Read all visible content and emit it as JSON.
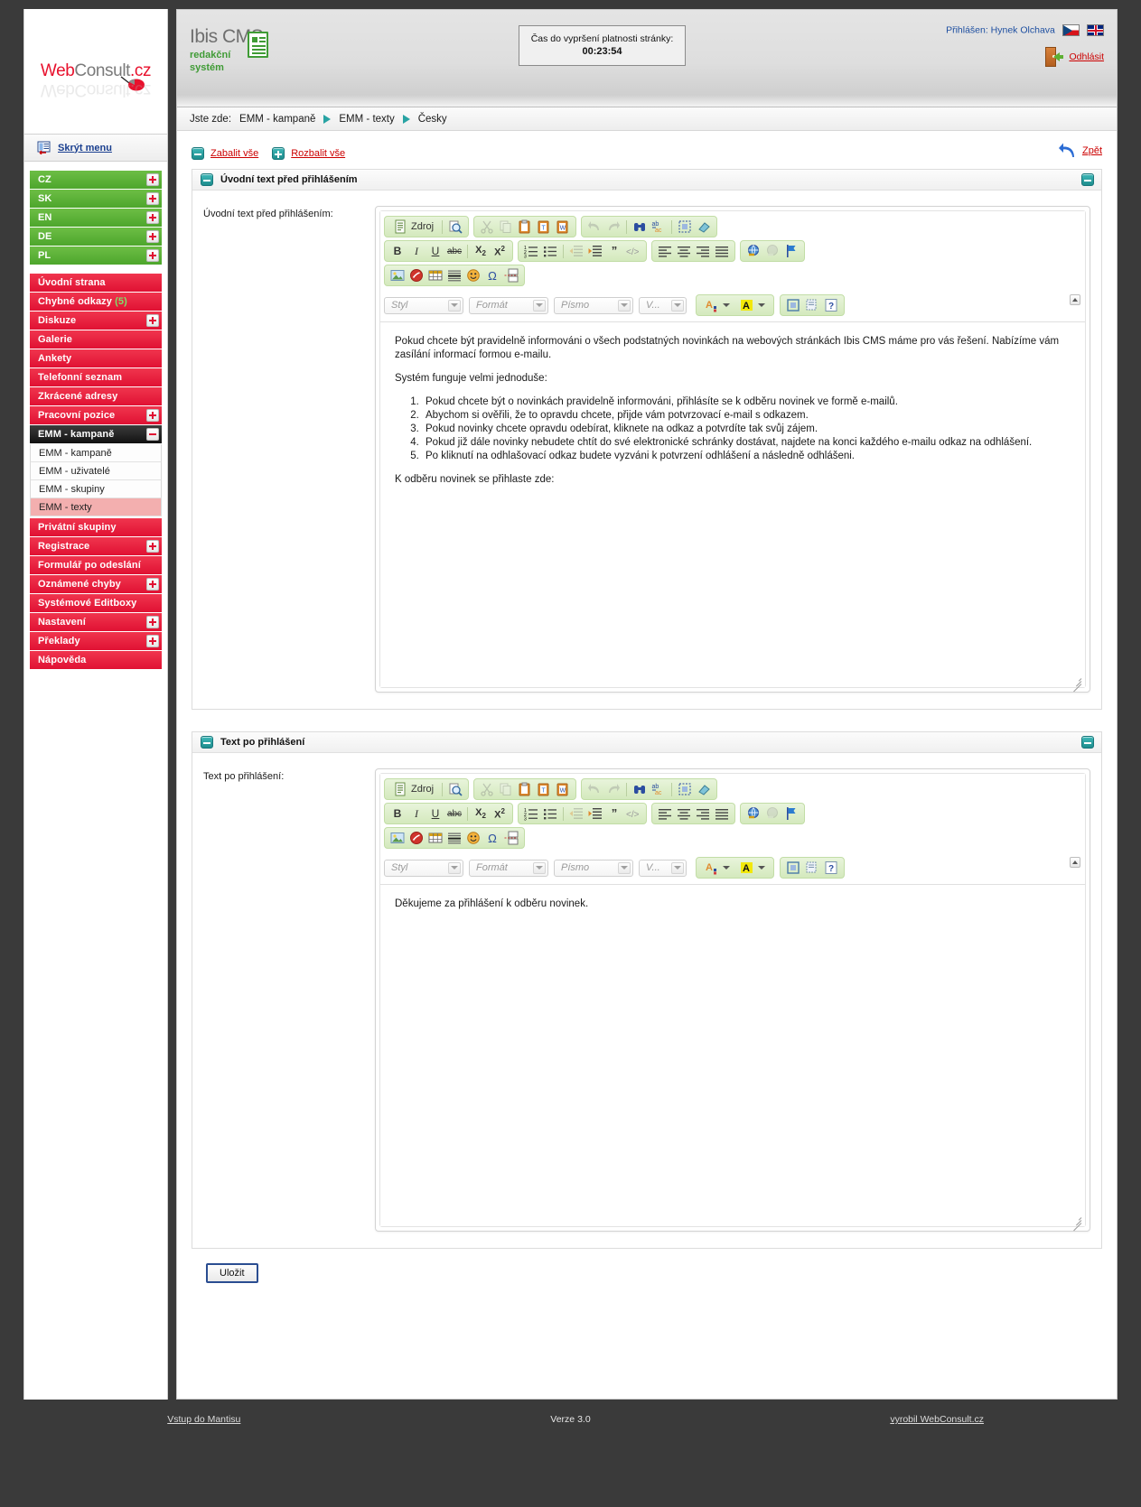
{
  "brand": {
    "logo_web": "Web",
    "logo_consult": "Consult",
    "logo_cz": ".cz",
    "cms_name": "Ibis CMS",
    "cms_sub1": "redakční",
    "cms_sub2": "systém"
  },
  "header": {
    "hide_menu": "Skrýt menu",
    "timer_label": "Čas do vypršení platnosti stránky:",
    "timer_value": "00:23:54",
    "logged_in": "Přihlášen: Hynek Olchava",
    "logout": "Odhlásit",
    "flag_cz": "cz-flag-icon",
    "flag_en": "en-flag-icon"
  },
  "breadcrumb": {
    "prefix": "Jste zde:",
    "items": [
      "EMM - kampaně",
      "EMM - texty",
      "Česky"
    ]
  },
  "toolbar": {
    "collapse_all": "Zabalit vše",
    "expand_all": "Rozbalit vše",
    "back": "Zpět"
  },
  "sidebar": {
    "languages": [
      {
        "label": "CZ",
        "expandable": true
      },
      {
        "label": "SK",
        "expandable": true
      },
      {
        "label": "EN",
        "expandable": true
      },
      {
        "label": "DE",
        "expandable": true
      },
      {
        "label": "PL",
        "expandable": true
      }
    ],
    "items": [
      {
        "label": "Úvodní strana",
        "expandable": false,
        "badge": ""
      },
      {
        "label": "Chybné odkazy",
        "expandable": false,
        "badge": "(5)"
      },
      {
        "label": "Diskuze",
        "expandable": true,
        "badge": ""
      },
      {
        "label": "Galerie",
        "expandable": false,
        "badge": ""
      },
      {
        "label": "Ankety",
        "expandable": false,
        "badge": ""
      },
      {
        "label": "Telefonní seznam",
        "expandable": false,
        "badge": ""
      },
      {
        "label": "Zkrácené adresy",
        "expandable": false,
        "badge": ""
      },
      {
        "label": "Pracovní pozice",
        "expandable": true,
        "badge": ""
      }
    ],
    "active_group": {
      "label": "EMM - kampaně",
      "collapsible": true
    },
    "sub_items": [
      {
        "label": "EMM - kampaně",
        "active": false
      },
      {
        "label": "EMM - uživatelé",
        "active": false
      },
      {
        "label": "EMM - skupiny",
        "active": false
      },
      {
        "label": "EMM - texty",
        "active": true
      }
    ],
    "items_after": [
      {
        "label": "Privátní skupiny",
        "expandable": false
      },
      {
        "label": "Registrace",
        "expandable": true
      },
      {
        "label": "Formulář po odeslání",
        "expandable": false
      },
      {
        "label": "Oznámené chyby",
        "expandable": true
      },
      {
        "label": "Systémové Editboxy",
        "expandable": false
      },
      {
        "label": "Nastavení",
        "expandable": true
      },
      {
        "label": "Překlady",
        "expandable": true
      },
      {
        "label": "Nápověda",
        "expandable": false
      }
    ]
  },
  "panels": [
    {
      "title": "Úvodní text před přihlášením",
      "field_label": "Úvodní text před přihlášením:",
      "editor": {
        "source_label": "Zdroj",
        "selects": [
          {
            "name": "styl",
            "value": "Styl"
          },
          {
            "name": "format",
            "value": "Formát"
          },
          {
            "name": "pismo",
            "value": "Písmo"
          },
          {
            "name": "velikost",
            "value": "V..."
          }
        ],
        "body": {
          "p1": "Pokud chcete být pravidelně informováni o všech podstatných novinkách na webových stránkách Ibis CMS máme pro vás řešení. Nabízíme vám zasílání informací formou e-mailu.",
          "p2": "Systém funguje velmi jednoduše:",
          "list": [
            "Pokud chcete být o novinkách pravidelně informováni, přihlásíte se k odběru novinek ve formě e-mailů.",
            "Abychom si ověřili, že to opravdu chcete, přijde vám potvrzovací e-mail s odkazem.",
            "Pokud novinky chcete opravdu odebírat, kliknete na odkaz a potvrdíte tak svůj zájem.",
            "Pokud již dále novinky nebudete chtít do své elektronické schránky dostávat, najdete na konci každého e-mailu odkaz na odhlášení.",
            "Po kliknutí na odhlašovací odkaz budete vyzváni k potvrzení odhlášení a následně odhlášeni."
          ],
          "p3": "K odběru novinek se přihlaste zde:"
        }
      }
    },
    {
      "title": "Text po přihlášení",
      "field_label": "Text po přihlášení:",
      "editor": {
        "source_label": "Zdroj",
        "selects": [
          {
            "name": "styl",
            "value": "Styl"
          },
          {
            "name": "format",
            "value": "Formát"
          },
          {
            "name": "pismo",
            "value": "Písmo"
          },
          {
            "name": "velikost",
            "value": "V..."
          }
        ],
        "body": {
          "p1": "Děkujeme za přihlášení k odběru novinek.",
          "p2": "",
          "list": [],
          "p3": ""
        }
      }
    }
  ],
  "actions": {
    "save": "Uložit"
  },
  "footer": {
    "left": "Vstup do Mantisu",
    "middle": "Verze 3.0",
    "right": "vyrobil WebConsult.cz"
  },
  "colors": {
    "brand_red": "#e8112d",
    "menu_red": "#e01133",
    "menu_green": "#4da62c",
    "teal": "#1e8d8d",
    "link_red": "#cc0000"
  }
}
